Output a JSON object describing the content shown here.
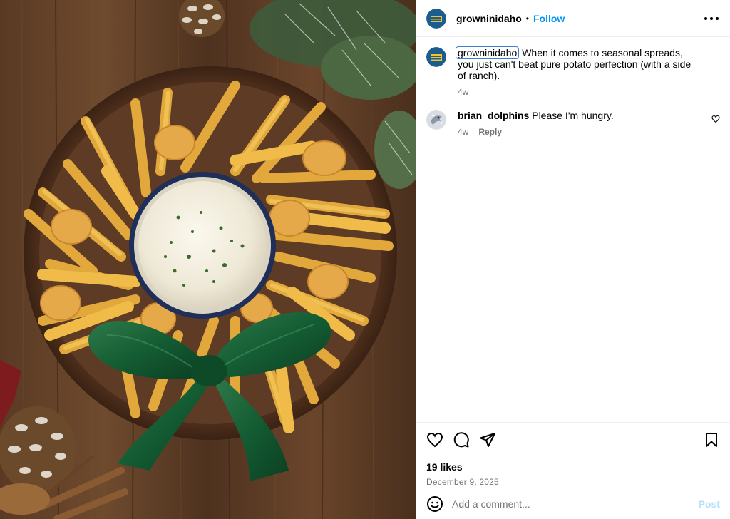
{
  "post": {
    "author": "growninidaho",
    "follow_label": "Follow",
    "separator": "•",
    "image_alt_subject": "Wreath of french fries, crinkle fries and tots around a ranch dip bowl tied with a green velvet bow"
  },
  "comments": [
    {
      "username": "growninidaho",
      "text": "When it comes to seasonal spreads, you just can't beat pure potato perfection (with a side of ranch).",
      "time": "4w",
      "is_caption": true
    },
    {
      "username": "brian_dolphins",
      "text": "Please I'm hungry.",
      "time": "4w",
      "reply_label": "Reply",
      "is_caption": false
    }
  ],
  "stats": {
    "likes": "19 likes",
    "date": "December 9, 2025"
  },
  "composer": {
    "placeholder": "Add a comment...",
    "post_label": "Post"
  },
  "icons": {
    "more": "more-horizontal-icon",
    "like": "heart-icon",
    "comment": "comment-icon",
    "share": "share-icon",
    "save": "bookmark-icon",
    "emoji": "emoji-icon"
  },
  "colors": {
    "link": "#0095f6",
    "muted": "#737373",
    "post_disabled": "#b2dffc",
    "border": "#dbdbdb"
  }
}
